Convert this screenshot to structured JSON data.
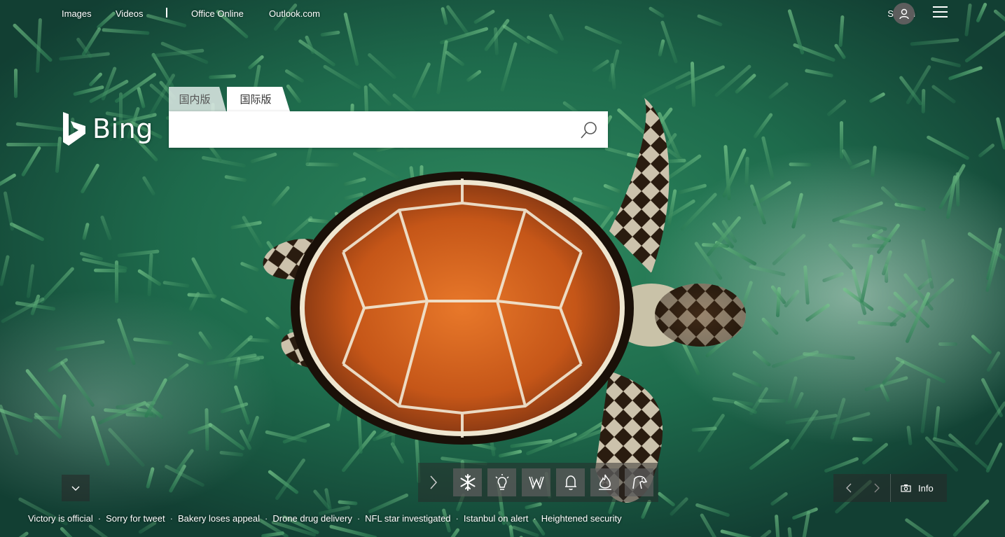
{
  "topnav": {
    "items": [
      {
        "label": "Images"
      },
      {
        "label": "Videos"
      },
      {
        "label": "Office Online"
      },
      {
        "label": "Outlook.com"
      }
    ],
    "signin_label": "Sign in"
  },
  "logo": {
    "text": "Bing"
  },
  "search": {
    "tabs": [
      {
        "label": "国内版",
        "active": false
      },
      {
        "label": "国际版",
        "active": true
      }
    ],
    "value": "",
    "placeholder": ""
  },
  "quick_icons": [
    {
      "name": "snowflake-icon"
    },
    {
      "name": "lightbulb-icon"
    },
    {
      "name": "wikipedia-icon"
    },
    {
      "name": "bell-icon"
    },
    {
      "name": "fire-icon"
    },
    {
      "name": "animal-icon"
    }
  ],
  "image_controls": {
    "info_label": "Info"
  },
  "headlines": [
    {
      "label": "Victory is official"
    },
    {
      "label": "Sorry for tweet"
    },
    {
      "label": "Bakery loses appeal"
    },
    {
      "label": "Drone drug delivery"
    },
    {
      "label": "NFL star investigated"
    },
    {
      "label": "Istanbul on alert"
    },
    {
      "label": "Heightened security"
    }
  ],
  "colors": {
    "grass": "#2f8a5f",
    "shell": "#c8561c",
    "control_bg": "#282828"
  }
}
